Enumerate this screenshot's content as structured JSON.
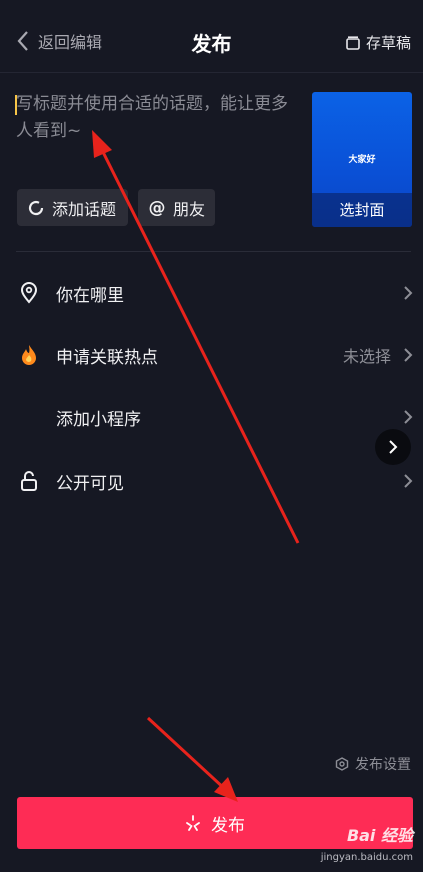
{
  "header": {
    "back_label": "返回编辑",
    "title": "发布",
    "draft_label": "存草稿"
  },
  "editor": {
    "caption_placeholder": "写标题并使用合适的话题，能让更多人看到~",
    "cover_text": "大家好",
    "cover_button": "选封面",
    "topic_button": "添加话题",
    "friend_button": "朋友",
    "at_glyph": "@"
  },
  "options": [
    {
      "label": "你在哪里",
      "value": "",
      "icon": "location-pin-icon"
    },
    {
      "label": "申请关联热点",
      "value": "未选择",
      "icon": "flame-icon"
    },
    {
      "label": "添加小程序",
      "value": "",
      "icon": ""
    },
    {
      "label": "公开可见",
      "value": "",
      "icon": "unlock-icon"
    }
  ],
  "footer": {
    "settings_label": "发布设置",
    "publish_label": "发布"
  },
  "watermark": {
    "logo_text": "Bai 经验",
    "url_text": "jingyan.baidu.com"
  },
  "colors": {
    "background": "#161823",
    "accent": "#fe2c55",
    "cover_blue": "#0b62e6",
    "annotation_arrow": "#e8231c"
  }
}
